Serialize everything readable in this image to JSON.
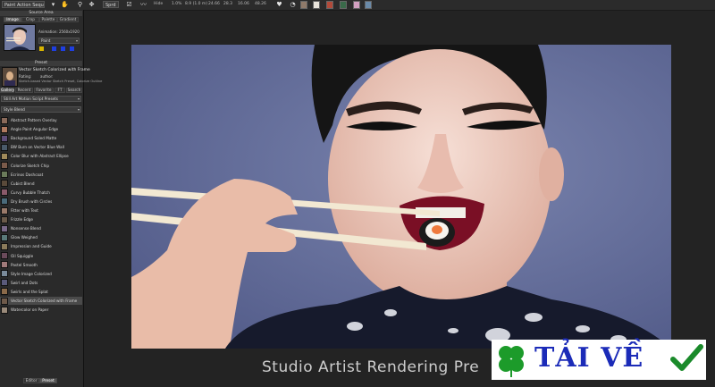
{
  "toolbar": {
    "source_select": "Paint Action Sequence",
    "view_select": "Sprd",
    "hide_label": "Hide",
    "zoom_values": [
      "1.0%",
      "8.9 (1.0 m)",
      "24.66",
      "28.3",
      "16.06",
      "48.26"
    ]
  },
  "panel": {
    "source_header": "Source Area",
    "source_tabs": [
      "Image",
      "Crop",
      "Palette",
      "Gradient"
    ],
    "source_info": "Animation: 2560x1920",
    "source_dropdown": "Paint",
    "preset_header": "Preset",
    "preset_name": "Vector Sketch Colorized with Frame",
    "preset_meta_1": "Rating:",
    "preset_meta_2": "author:",
    "preset_desc": "Sketch-based Vector Sketch Preset, Colorize Outline",
    "preset_tabs": [
      "Gallery",
      "Recent",
      "Favorite",
      "FT",
      "Search"
    ],
    "category_dropdown": "Still Art Motion Script Presets",
    "subcategory_dropdown": "Style Blend",
    "presets": [
      "Abstract Pattern Overlay",
      "Angle Paint Angular Edge",
      "Background Soled Matte",
      "BW Burn on Vector Blue Wall",
      "Color Blur with Abstract Ellipse",
      "Colorize Sketch Chip",
      "Ecrinos Dashcoat",
      "Cubist Blend",
      "Curvy Bubble Thatch",
      "Dry Brush with Circles",
      "Fitter with Text",
      "Frizzle Edge",
      "Nonsense Blend",
      "Glow Weighed",
      "Impression and Guide",
      "Oil Squiggle",
      "Pastel Smooth",
      "Style Image Colorized",
      "Swirl and Dots",
      "Swirls and the Splat",
      "Vector Sketch Colorized with Frame",
      "Watercolor on Paper"
    ],
    "selected_index": 20,
    "bottom_tabs": [
      "Editor",
      "Preset"
    ]
  },
  "canvas": {
    "caption": "Studio Artist Rendering Pre"
  },
  "watermark": {
    "text": "TẢI VỀ"
  },
  "colors": {
    "accent": "#1b2bb8",
    "clover": "#1c9b2a",
    "check": "#1a8a2a",
    "photo_bg": "#646e98"
  }
}
